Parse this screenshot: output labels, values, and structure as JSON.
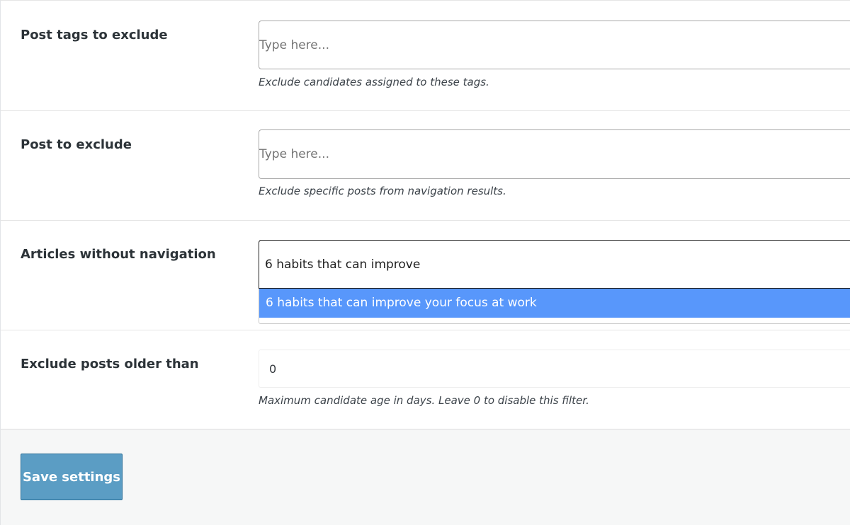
{
  "fields": {
    "post_tags": {
      "label": "Post tags to exclude",
      "placeholder": "Type here...",
      "description": "Exclude candidates assigned to these tags."
    },
    "post_exclude": {
      "label": "Post to exclude",
      "placeholder": "Type here...",
      "description": "Exclude specific posts from navigation results."
    },
    "articles_no_nav": {
      "label": "Articles without navigation",
      "value": "6 habits that can improve",
      "suggestion": "6 habits that can improve your focus at work"
    },
    "older_than": {
      "label": "Exclude posts older than",
      "value": "0",
      "description": "Maximum candidate age in days. Leave 0 to disable this filter."
    }
  },
  "footer": {
    "save_label": "Save settings"
  },
  "colors": {
    "highlight": "#5897fb",
    "button": "#5b9dc4"
  }
}
